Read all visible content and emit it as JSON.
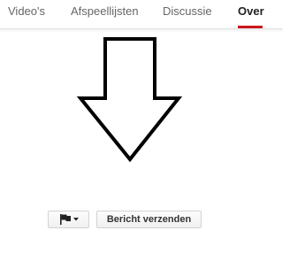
{
  "tabs": [
    {
      "label": "Video's",
      "active": false
    },
    {
      "label": "Afspeellijsten",
      "active": false
    },
    {
      "label": "Discussie",
      "active": false
    },
    {
      "label": "Over",
      "active": true
    }
  ],
  "accent_color": "#cc181e",
  "annotation": {
    "icon": "down-arrow-icon"
  },
  "actions": {
    "flag_icon": "flag-icon",
    "flag_menu_icon": "caret-down-icon",
    "send_message_label": "Bericht verzenden"
  }
}
